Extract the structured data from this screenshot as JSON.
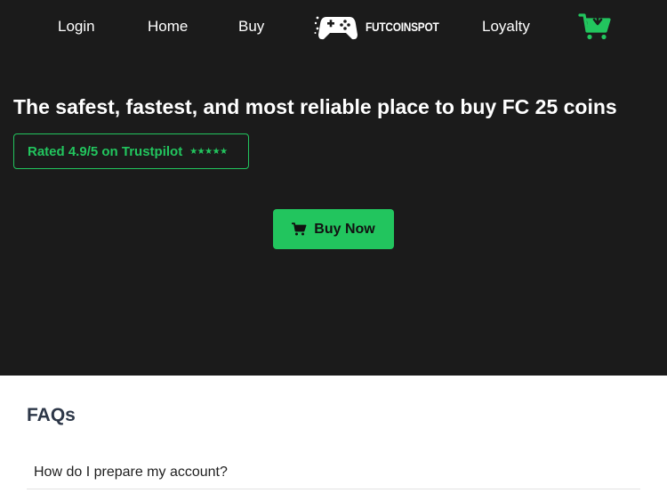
{
  "nav": {
    "login": "Login",
    "home": "Home",
    "buy": "Buy",
    "logo_text": "FUTCOINSPOT",
    "loyalty": "Loyalty"
  },
  "hero": {
    "headline": "The safest, fastest, and most reliable place to buy FC 25 coins",
    "trust_text": "Rated 4.9/5 on Trustpilot",
    "trust_stars": "★★★★★",
    "buy_label": "Buy Now"
  },
  "faq": {
    "title": "FAQs",
    "items": [
      {
        "question": "How do I prepare my account?"
      }
    ]
  },
  "colors": {
    "accent": "#22c55e",
    "hero_bg": "#1b1b1b",
    "faq_title": "#2d3748"
  },
  "icons": {
    "logo": "gamepad-icon",
    "cart": "cart-icon"
  }
}
